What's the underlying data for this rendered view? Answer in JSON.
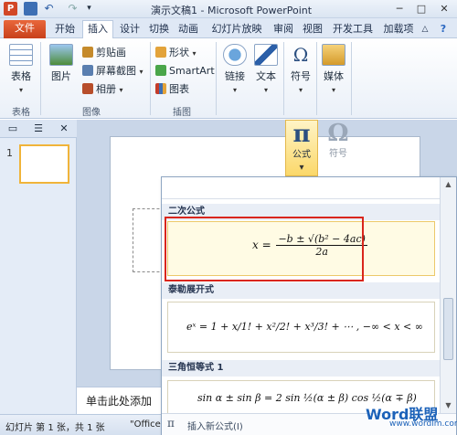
{
  "window": {
    "title": "演示文稿1 - Microsoft PowerPoint",
    "app_icon": "P"
  },
  "tabs": [
    "文件",
    "开始",
    "插入",
    "设计",
    "切换",
    "动画",
    "幻灯片放映",
    "审阅",
    "视图",
    "开发工具",
    "加载项"
  ],
  "ribbon": {
    "table": {
      "label": "表格",
      "group": "表格"
    },
    "image": {
      "picture": "图片",
      "clipart": "剪贴画",
      "screenshot": "屏幕截图",
      "album": "相册",
      "group": "图像"
    },
    "illustrations": {
      "shapes": "形状",
      "smartart": "SmartArt",
      "chart": "图表",
      "group": "插图"
    },
    "link": {
      "label": "链接"
    },
    "text": {
      "label": "文本"
    },
    "symbols": {
      "label": "符号"
    },
    "media": {
      "label": "媒体"
    }
  },
  "equation": {
    "formula_label": "公式",
    "symbol_label": "符号",
    "pi": "π",
    "omega": "Ω"
  },
  "gallery": {
    "sections": [
      {
        "title": "二次公式"
      },
      {
        "title": "泰勒展开式"
      },
      {
        "title": "三角恒等式 1"
      }
    ],
    "quadratic": {
      "lhs": "x =",
      "numerator": "−b ± √(b² − 4ac)",
      "denominator": "2a"
    },
    "taylor": {
      "text": "eˣ = 1 + x/1! + x²/2! + x³/3! + ⋯ ,     −∞ < x < ∞"
    },
    "trig": {
      "text": "sin α ± sin β = 2 sin ½(α ± β) cos ½(α ∓ β)"
    },
    "insert_new": "插入新公式(I)"
  },
  "notes": {
    "placeholder": "单击此处添加"
  },
  "status": {
    "slide_info": "幻灯片 第 1 张，共 1 张",
    "theme": "\"Office"
  },
  "panel": {
    "slide_number": "1"
  },
  "watermark": {
    "brand": "Word联盟",
    "url": "www.wordlm.com"
  }
}
